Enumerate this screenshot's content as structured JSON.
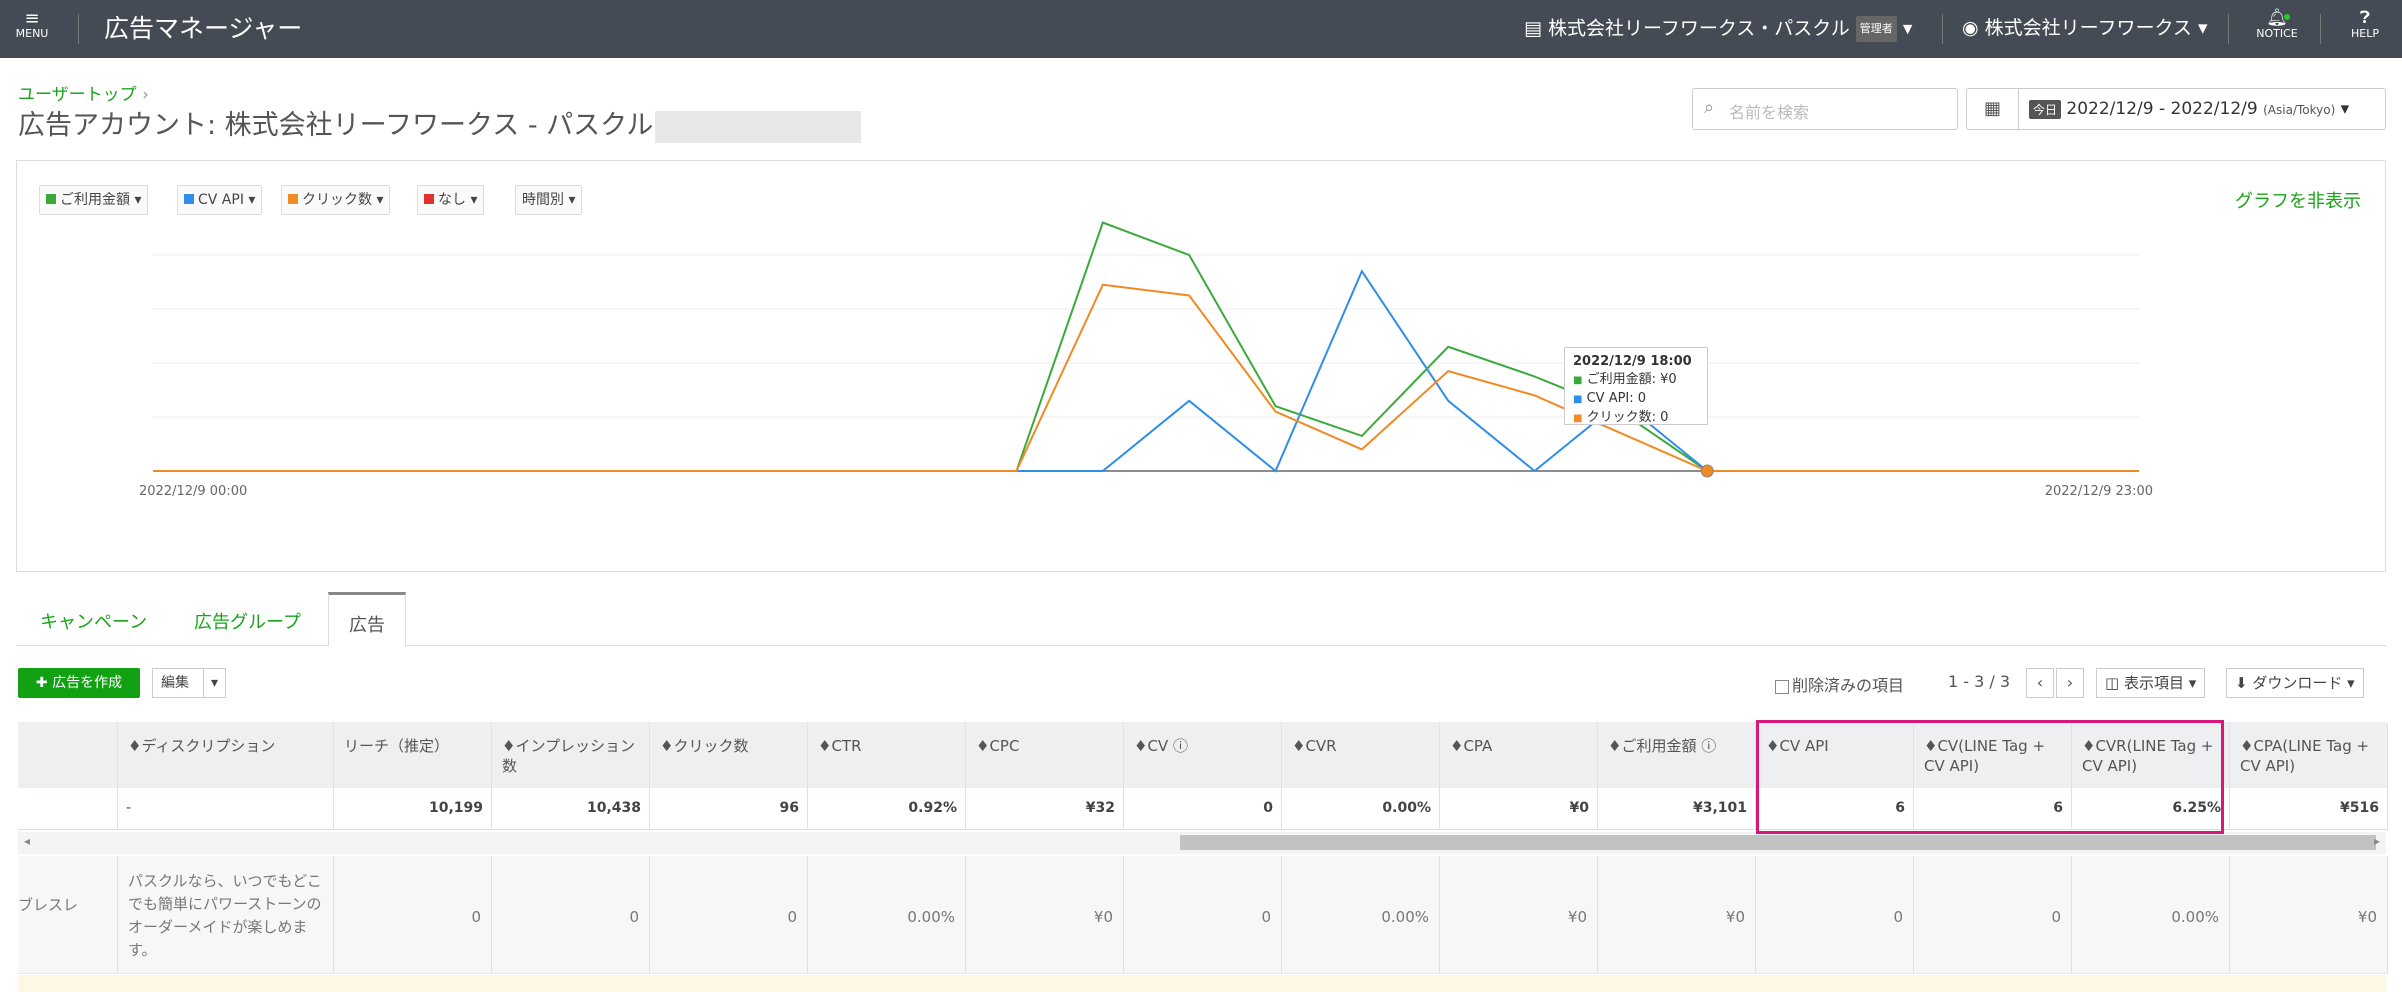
{
  "header": {
    "menu_label": "MENU",
    "title": "広告マネージャー",
    "account": "株式会社リーフワークス・パスクル",
    "account_role": "管理者",
    "user": "株式会社リーフワークス",
    "notice_label": "NOTICE",
    "help_label": "HELP"
  },
  "breadcrumb": {
    "label": "ユーザートップ",
    "sep": "›"
  },
  "page_title": "広告アカウント: 株式会社リーフワークス - パスクル",
  "search": {
    "placeholder": "名前を検索"
  },
  "date_range": {
    "today_badge": "今日",
    "range": "2022/12/9 - 2022/12/9",
    "timezone": "(Asia/Tokyo)",
    "caret": "▾"
  },
  "chart_controls": [
    {
      "label": "ご利用金額",
      "color": "#3aa93a"
    },
    {
      "label": "CV API",
      "color": "#2f8ee8"
    },
    {
      "label": "クリック数",
      "color": "#f08a24"
    },
    {
      "label": "なし",
      "color": "#e03030"
    },
    {
      "label": "時間別",
      "color": ""
    }
  ],
  "hide_graph_label": "グラフを非表示",
  "chart_data": {
    "type": "line",
    "x": [
      "00:00",
      "01:00",
      "02:00",
      "03:00",
      "04:00",
      "05:00",
      "06:00",
      "07:00",
      "08:00",
      "09:00",
      "10:00",
      "11:00",
      "12:00",
      "13:00",
      "14:00",
      "15:00",
      "16:00",
      "17:00",
      "18:00",
      "19:00",
      "20:00",
      "21:00",
      "22:00",
      "23:00"
    ],
    "x_tick_labels": [
      "2022/12/9 00:00",
      "2022/12/9 23:00"
    ],
    "series": [
      {
        "name": "ご利用金額",
        "color": "#3aa93a",
        "values": [
          0,
          0,
          0,
          0,
          0,
          0,
          0,
          0,
          0,
          0,
          0,
          9.2,
          8,
          2.4,
          1.3,
          4.6,
          3.5,
          2.2,
          0,
          0,
          0,
          0,
          0,
          0
        ]
      },
      {
        "name": "CV API",
        "color": "#2f8ee8",
        "values": [
          0,
          0,
          0,
          0,
          0,
          0,
          0,
          0,
          0,
          0,
          0,
          0,
          2.6,
          0,
          7.4,
          2.6,
          0,
          2.6,
          0,
          0,
          0,
          0,
          0,
          0
        ]
      },
      {
        "name": "クリック数",
        "color": "#f08a24",
        "values": [
          0,
          0,
          0,
          0,
          0,
          0,
          0,
          0,
          0,
          0,
          0,
          6.9,
          6.5,
          2.2,
          0.8,
          3.7,
          2.8,
          1.4,
          0,
          0,
          0,
          0,
          0,
          0
        ]
      }
    ],
    "grid": true,
    "tooltip": {
      "title": "2022/12/9 18:00",
      "items": [
        "ご利用金額: ¥0",
        "CV API: 0",
        "クリック数: 0"
      ]
    }
  },
  "tabs": [
    {
      "label": "キャンペーン"
    },
    {
      "label": "広告グループ"
    },
    {
      "label": "広告"
    }
  ],
  "toolbar": {
    "create_label": "✚ 広告を作成",
    "edit_label": "編集",
    "deleted_label": "削除済みの項目",
    "pager": "1 - 3 / 3",
    "columns_label": "◫ 表示項目 ▾",
    "download_label": "⬇ ダウンロード ▾"
  },
  "table": {
    "headers": [
      "",
      "♦ディスクリプション",
      "リーチ（推定）",
      "♦インプレッション数",
      "♦クリック数",
      "♦CTR",
      "♦CPC",
      "♦CV ⓘ",
      "♦CVR",
      "♦CPA",
      "♦ご利用金額 ⓘ",
      "♦CV API",
      "♦CV(LINE Tag + CV API)",
      "♦CVR(LINE Tag + CV API)",
      "♦CPA(LINE Tag + CV API)"
    ],
    "reach_help": "ⓘ",
    "totals": [
      "",
      "-",
      "10,199",
      "10,438",
      "96",
      "0.92%",
      "¥32",
      "0",
      "0.00%",
      "¥0",
      "¥3,101",
      "6",
      "6",
      "6.25%",
      "¥516"
    ],
    "row1": [
      "ブレスレ",
      "パスクルなら、いつでもどこでも簡単にパワーストーンのオーダーメイドが楽しめます。",
      "0",
      "0",
      "0",
      "0.00%",
      "¥0",
      "0",
      "0.00%",
      "¥0",
      "¥0",
      "0",
      "0",
      "0.00%",
      "¥0"
    ]
  }
}
